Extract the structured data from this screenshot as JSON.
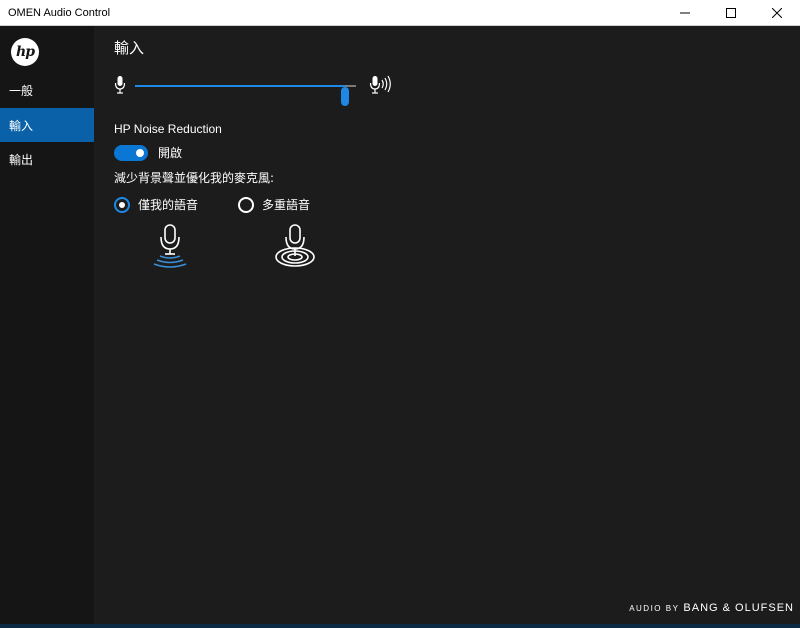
{
  "window": {
    "title": "OMEN Audio Control"
  },
  "colors": {
    "accent": "#0a61a8",
    "slider": "#1e88e5",
    "toggle_on": "#0a77d4",
    "background": "#1c1c1c",
    "sidebar": "#151515"
  },
  "sidebar": {
    "logo": "hp",
    "items": [
      {
        "label": "一般",
        "active": false
      },
      {
        "label": "輸入",
        "active": true
      },
      {
        "label": "輸出",
        "active": false
      }
    ]
  },
  "main": {
    "title": "輸入",
    "volume": {
      "level_fraction": 0.95,
      "low_icon": "mic-icon",
      "high_icon": "mic-loud-icon"
    },
    "noise_reduction": {
      "title": "HP Noise Reduction",
      "toggle_state": "on",
      "toggle_label": "開啟",
      "description": "減少背景聲並優化我的麥克風:",
      "options": [
        {
          "label": "僅我的語音",
          "selected": true,
          "icon": "mic-directional-icon"
        },
        {
          "label": "多重語音",
          "selected": false,
          "icon": "mic-omni-icon"
        }
      ]
    }
  },
  "footer": {
    "audio_by": "AUDIO BY",
    "brand": "BANG & OLUFSEN"
  }
}
